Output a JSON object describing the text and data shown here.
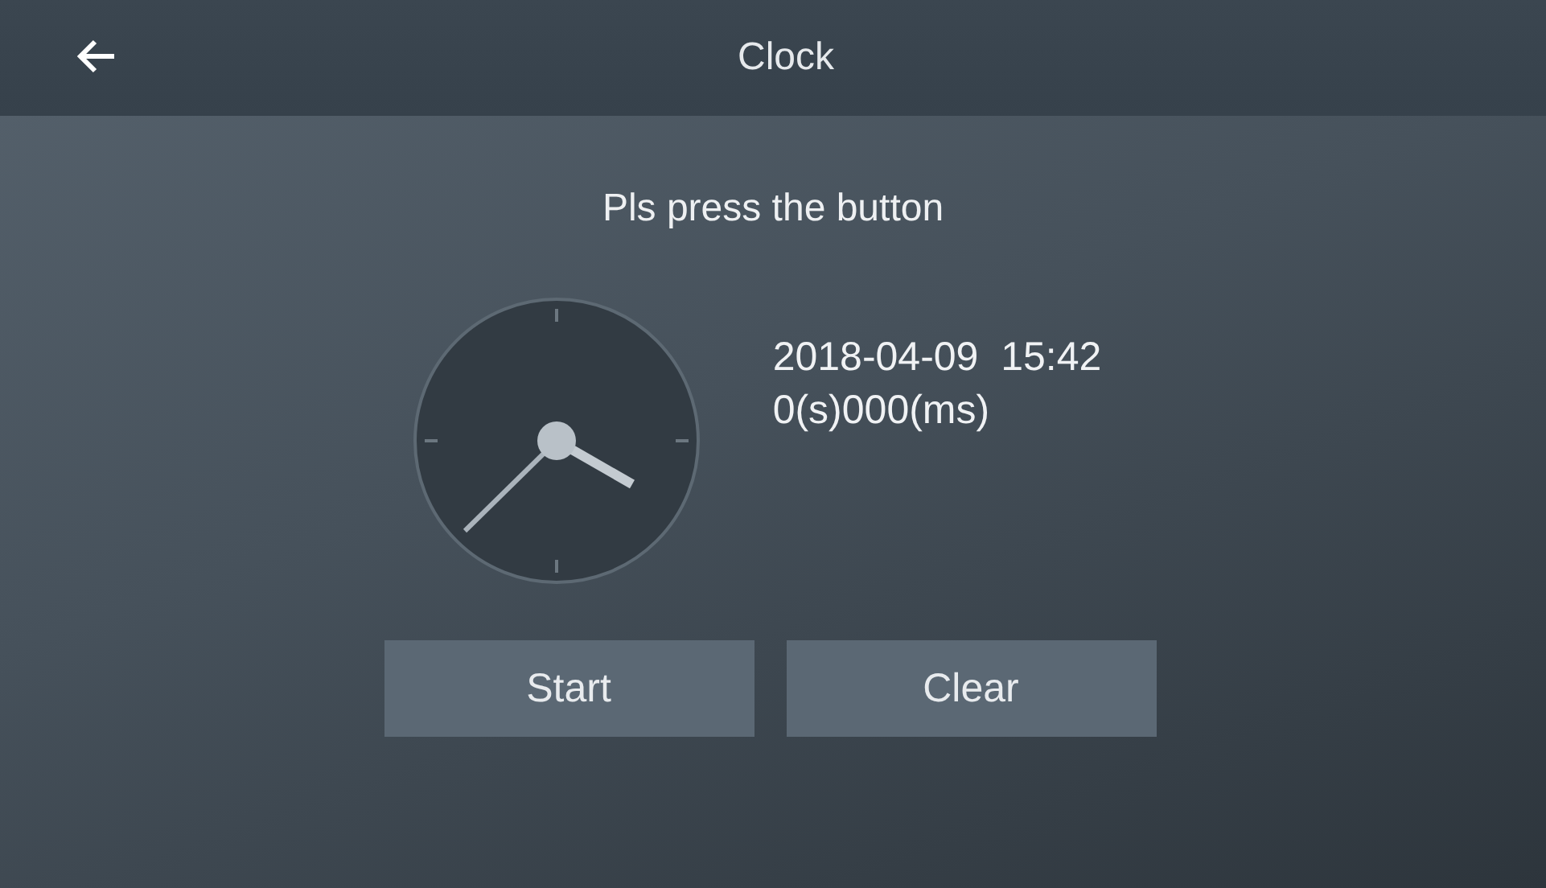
{
  "header": {
    "title": "Clock"
  },
  "prompt": "Pls press the button",
  "datetime": "2018-04-09  15:42",
  "timer": "0(s)000(ms)",
  "buttons": [
    "Start",
    "Clear"
  ]
}
